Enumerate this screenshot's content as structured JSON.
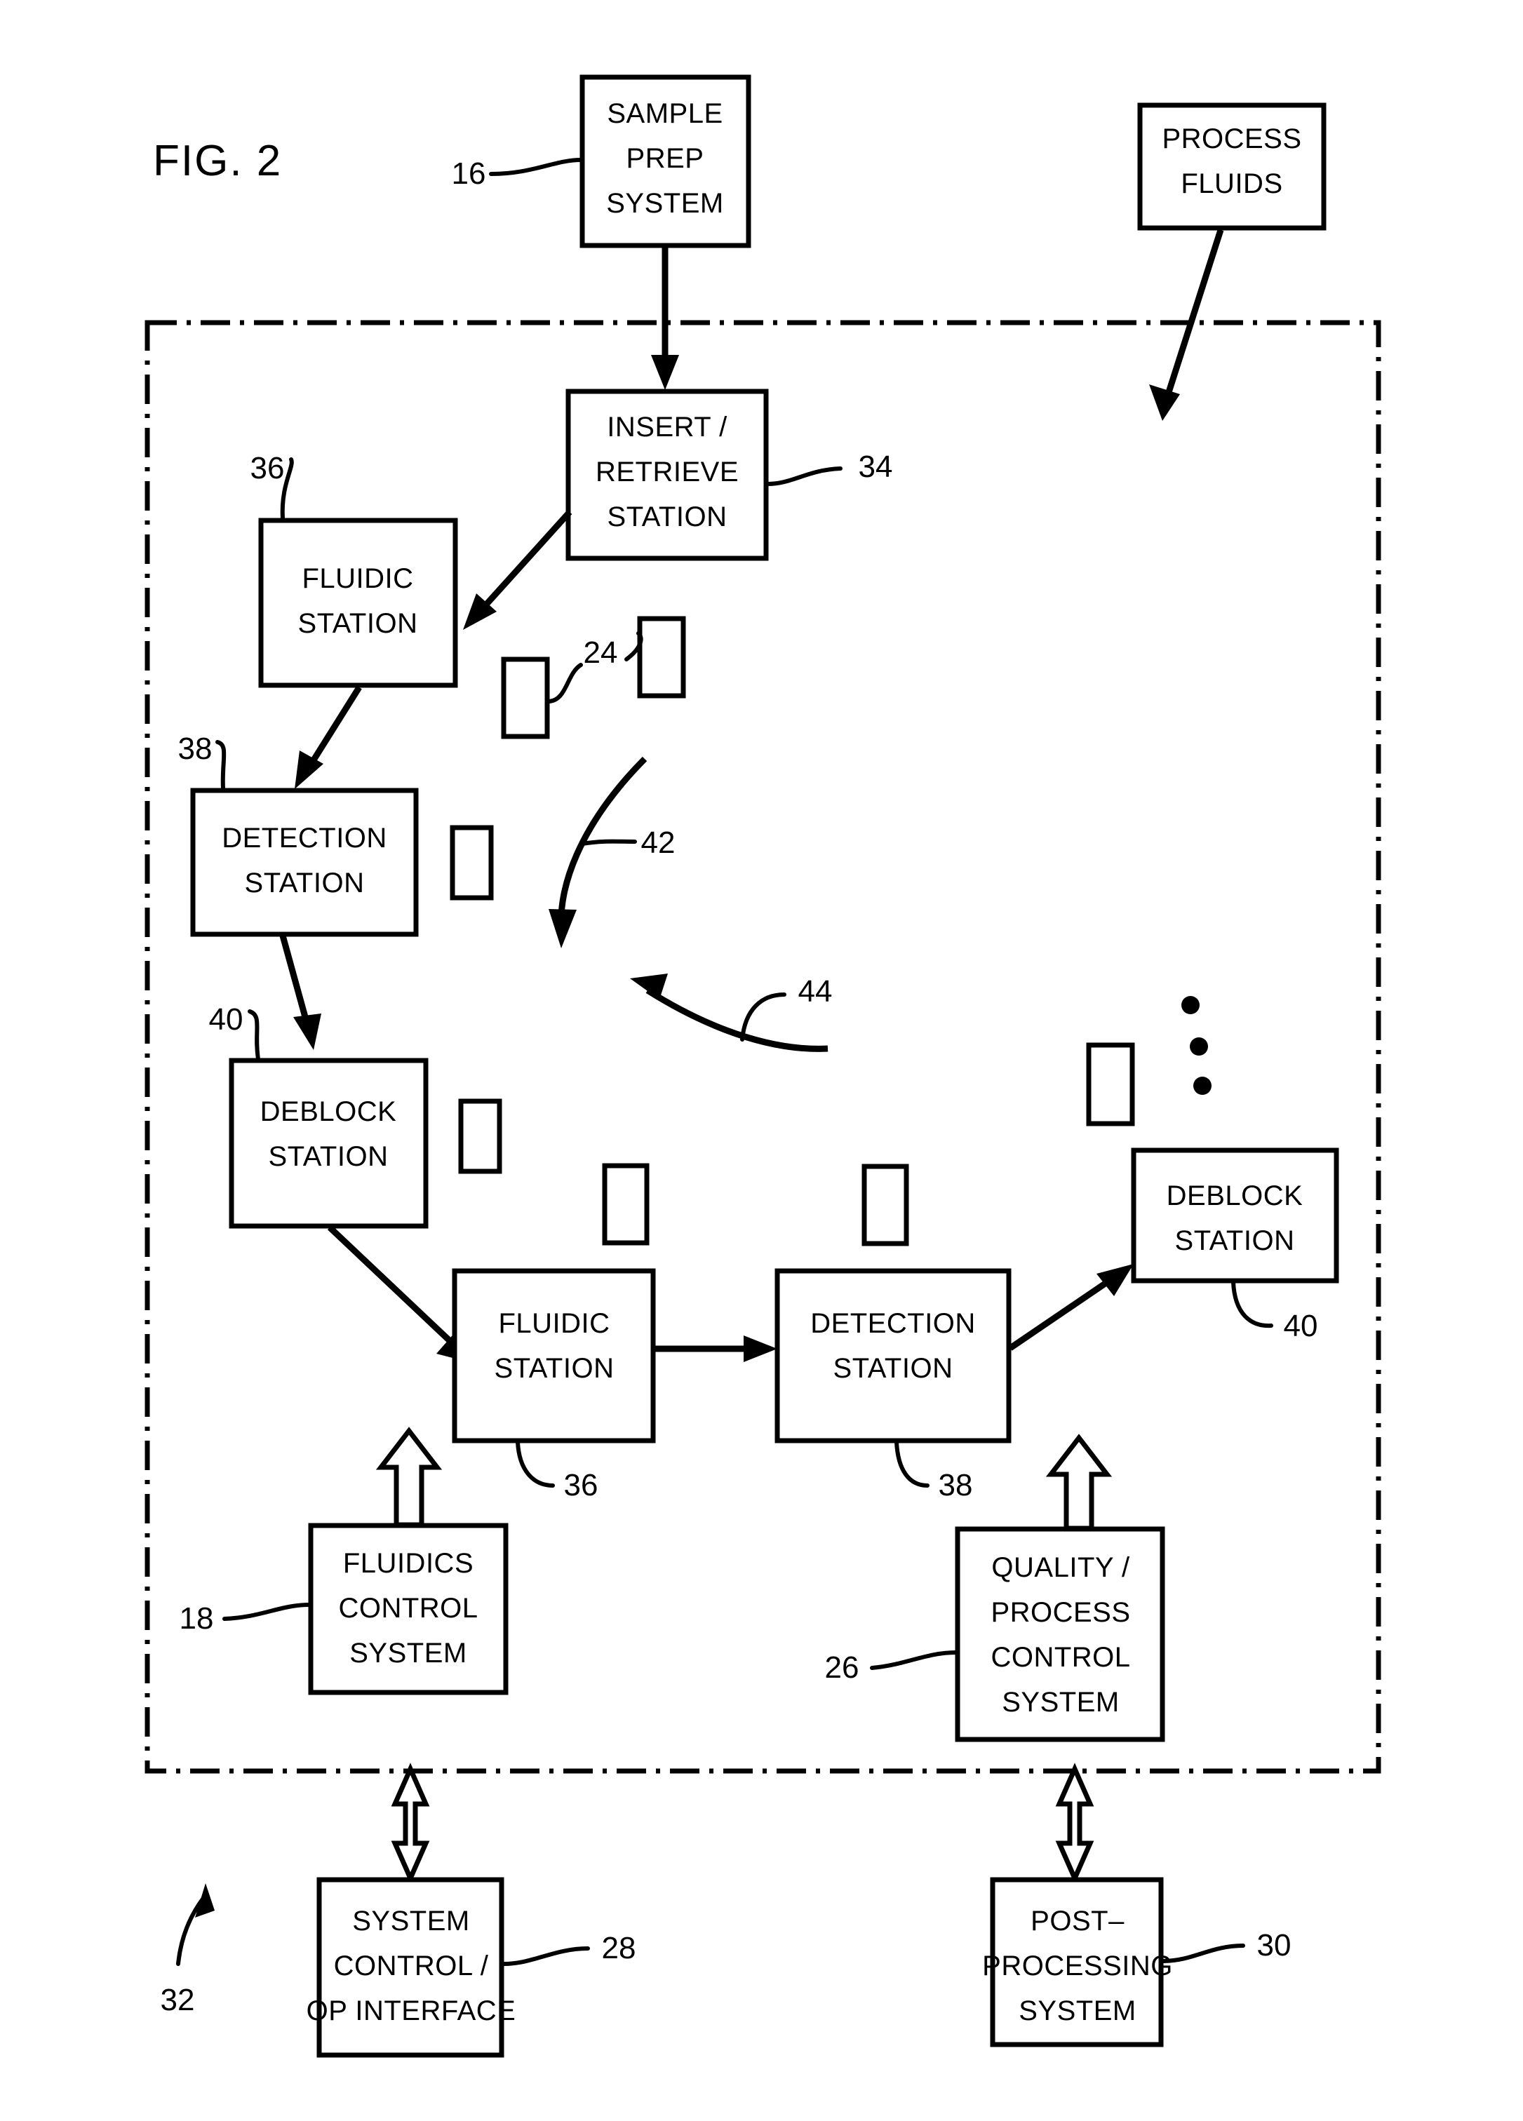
{
  "figure": {
    "title": "FIG. 2",
    "enclosure_name": "instrument-boundary"
  },
  "boxes": {
    "sample_prep": {
      "line1": "SAMPLE",
      "line2": "PREP",
      "line3": "SYSTEM"
    },
    "process_fluids": {
      "line1": "PROCESS",
      "line2": "FLUIDS"
    },
    "insert_retrieve": {
      "line1": "INSERT /",
      "line2": "RETRIEVE",
      "line3": "STATION"
    },
    "fluidic_station_top": {
      "line1": "FLUIDIC",
      "line2": "STATION"
    },
    "detection_station_left": {
      "line1": "DETECTION",
      "line2": "STATION"
    },
    "deblock_station_left": {
      "line1": "DEBLOCK",
      "line2": "STATION"
    },
    "fluidic_station_mid": {
      "line1": "FLUIDIC",
      "line2": "STATION"
    },
    "detection_station_mid": {
      "line1": "DETECTION",
      "line2": "STATION"
    },
    "deblock_station_right": {
      "line1": "DEBLOCK",
      "line2": "STATION"
    },
    "fluidics_control": {
      "line1": "FLUIDICS",
      "line2": "CONTROL",
      "line3": "SYSTEM"
    },
    "quality_process_control": {
      "line1": "QUALITY /",
      "line2": "PROCESS",
      "line3": "CONTROL",
      "line4": "SYSTEM"
    },
    "system_control": {
      "line1": "SYSTEM",
      "line2": "CONTROL /",
      "line3": "OP  INTERFACE"
    },
    "post_processing": {
      "line1": "POST–",
      "line2": "PROCESSING",
      "line3": "SYSTEM"
    }
  },
  "reference_numerals": {
    "sample_prep": "16",
    "fluidics_control": "18",
    "substrate": "24",
    "quality_process_control": "26",
    "system_control": "28",
    "post_processing": "30",
    "system_overall": "32",
    "insert_retrieve": "34",
    "fluidic_station_top": "36",
    "fluidic_station_mid": "36",
    "detection_station_left": "38",
    "detection_station_mid": "38",
    "deblock_station_left": "40",
    "deblock_station_right": "40",
    "transport_path_out": "42",
    "transport_path_return": "44"
  },
  "colors": {
    "ink": "#000000",
    "background": "#ffffff"
  }
}
